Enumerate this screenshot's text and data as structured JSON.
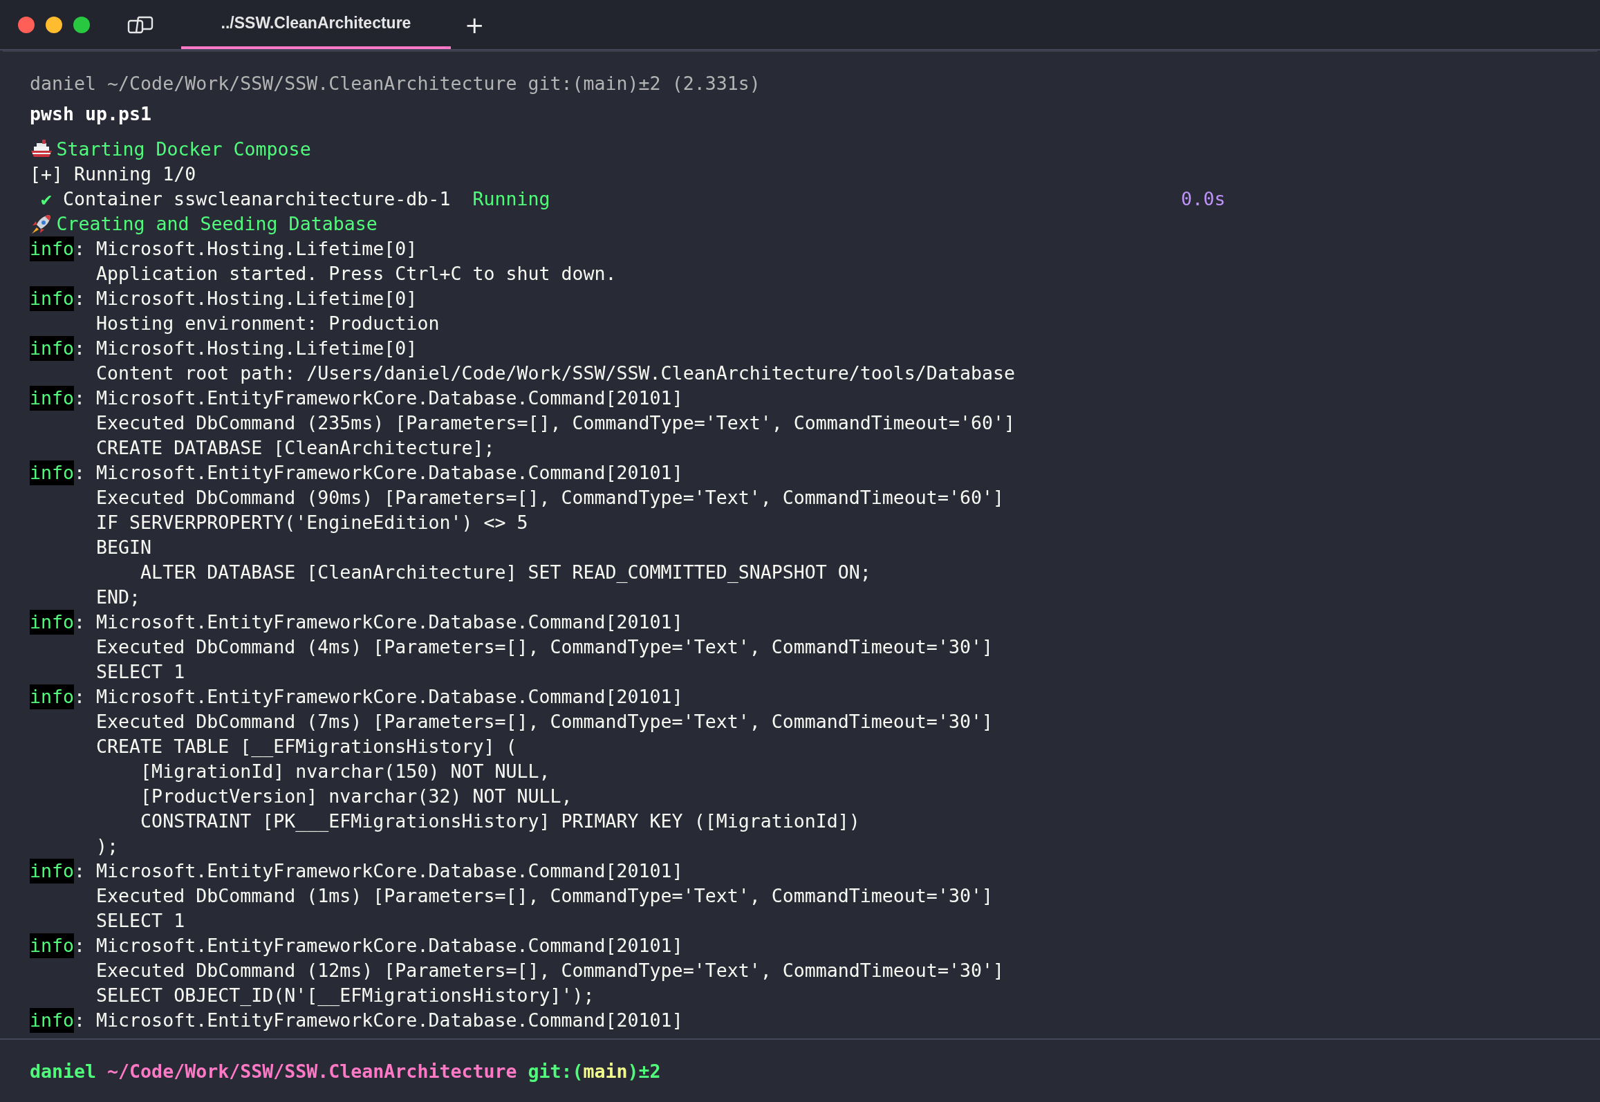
{
  "window": {
    "buttons": [
      {
        "color": "#ff5f57"
      },
      {
        "color": "#febc2e"
      },
      {
        "color": "#28c840"
      }
    ]
  },
  "tabs": [
    {
      "label": "../SSW.CleanArchitecture",
      "selected": true
    }
  ],
  "new_tab": "+",
  "lines": [
    {
      "kind": "prompt_echo",
      "text": "daniel ~/Code/Work/SSW/SSW.CleanArchitecture git:(main)±2 (2.331s)"
    },
    {
      "kind": "command",
      "text": "pwsh up.ps1"
    },
    {
      "kind": "step",
      "text": "Starting Docker Compose"
    },
    {
      "kind": "plain",
      "text": "[+] Running 1/0"
    },
    {
      "kind": "container",
      "mark": "✔",
      "text": "Container sswcleanarchitecture-db-1",
      "status": "Running",
      "time": "0.0s"
    },
    {
      "kind": "step",
      "text": "Creating and Seeding Database"
    },
    {
      "kind": "log",
      "level": "info",
      "text": ": Microsoft.Hosting.Lifetime[0]"
    },
    {
      "kind": "continuation",
      "text": "Application started. Press Ctrl+C to shut down."
    },
    {
      "kind": "log",
      "level": "info",
      "text": ": Microsoft.Hosting.Lifetime[0]"
    },
    {
      "kind": "continuation",
      "text": "Hosting environment: Production"
    },
    {
      "kind": "log",
      "level": "info",
      "text": ": Microsoft.Hosting.Lifetime[0]"
    },
    {
      "kind": "continuation",
      "text": "Content root path: /Users/daniel/Code/Work/SSW/SSW.CleanArchitecture/tools/Database"
    },
    {
      "kind": "log",
      "level": "info",
      "text": ": Microsoft.EntityFrameworkCore.Database.Command[20101]"
    },
    {
      "kind": "continuation",
      "text": "Executed DbCommand (235ms) [Parameters=[], CommandType='Text', CommandTimeout='60']"
    },
    {
      "kind": "continuation",
      "text": "CREATE DATABASE [CleanArchitecture];"
    },
    {
      "kind": "log",
      "level": "info",
      "text": ": Microsoft.EntityFrameworkCore.Database.Command[20101]"
    },
    {
      "kind": "continuation",
      "text": "Executed DbCommand (90ms) [Parameters=[], CommandType='Text', CommandTimeout='60']"
    },
    {
      "kind": "continuation",
      "text": "IF SERVERPROPERTY('EngineEdition') <> 5"
    },
    {
      "kind": "continuation",
      "text": "BEGIN"
    },
    {
      "kind": "continuation",
      "text": "    ALTER DATABASE [CleanArchitecture] SET READ_COMMITTED_SNAPSHOT ON;"
    },
    {
      "kind": "continuation",
      "text": "END;"
    },
    {
      "kind": "log",
      "level": "info",
      "text": ": Microsoft.EntityFrameworkCore.Database.Command[20101]"
    },
    {
      "kind": "continuation",
      "text": "Executed DbCommand (4ms) [Parameters=[], CommandType='Text', CommandTimeout='30']"
    },
    {
      "kind": "continuation",
      "text": "SELECT 1"
    },
    {
      "kind": "log",
      "level": "info",
      "text": ": Microsoft.EntityFrameworkCore.Database.Command[20101]"
    },
    {
      "kind": "continuation",
      "text": "Executed DbCommand (7ms) [Parameters=[], CommandType='Text', CommandTimeout='30']"
    },
    {
      "kind": "continuation",
      "text": "CREATE TABLE [__EFMigrationsHistory] ("
    },
    {
      "kind": "continuation",
      "text": "    [MigrationId] nvarchar(150) NOT NULL,"
    },
    {
      "kind": "continuation",
      "text": "    [ProductVersion] nvarchar(32) NOT NULL,"
    },
    {
      "kind": "continuation",
      "text": "    CONSTRAINT [PK___EFMigrationsHistory] PRIMARY KEY ([MigrationId])"
    },
    {
      "kind": "continuation",
      "text": ");"
    },
    {
      "kind": "log",
      "level": "info",
      "text": ": Microsoft.EntityFrameworkCore.Database.Command[20101]"
    },
    {
      "kind": "continuation",
      "text": "Executed DbCommand (1ms) [Parameters=[], CommandType='Text', CommandTimeout='30']"
    },
    {
      "kind": "continuation",
      "text": "SELECT 1"
    },
    {
      "kind": "log",
      "level": "info",
      "text": ": Microsoft.EntityFrameworkCore.Database.Command[20101]"
    },
    {
      "kind": "continuation",
      "text": "Executed DbCommand (12ms) [Parameters=[], CommandType='Text', CommandTimeout='30']"
    },
    {
      "kind": "continuation",
      "text": "SELECT OBJECT_ID(N'[__EFMigrationsHistory]');"
    },
    {
      "kind": "log",
      "level": "info",
      "text": ": Microsoft.EntityFrameworkCore.Database.Command[20101]"
    }
  ],
  "prompt": {
    "user": "daniel",
    "path": "~/Code/Work/SSW/SSW.CleanArchitecture",
    "git_open": "git:(",
    "branch": "main",
    "git_close": ")±2"
  }
}
